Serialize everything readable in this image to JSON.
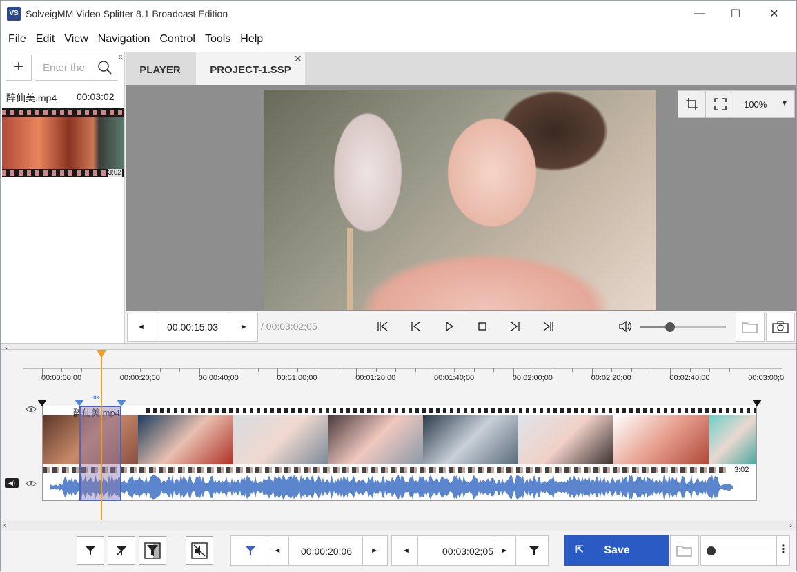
{
  "window": {
    "app_icon": "VS",
    "title": "SolveigMM Video Splitter 8.1 Broadcast Edition",
    "minimize": "—",
    "maximize": "☐",
    "close": "✕"
  },
  "menu": [
    "File",
    "Edit",
    "View",
    "Navigation",
    "Control",
    "Tools",
    "Help"
  ],
  "left_panel": {
    "add": "+",
    "search_placeholder": "Enter the",
    "collapse": "«",
    "file": {
      "name": "醉仙美.mp4",
      "duration": "00:03:02",
      "thumb_time": "3:02"
    }
  },
  "tabs": {
    "player": "PLAYER",
    "project": "PROJECT-1.SSP",
    "close": "✕"
  },
  "player": {
    "zoom": "100%",
    "zoom_arrow": "▼"
  },
  "transport": {
    "prev": "◄",
    "next": "►",
    "current_time": "00:00:15;03",
    "total_duration": "/ 00:03:02;05",
    "volume_level": 0.35
  },
  "timeline": {
    "ticks": [
      "00:00:00;00",
      "00:00:20;00",
      "00:00:40;00",
      "00:01:00;00",
      "00:01:20;00",
      "00:01:40;00",
      "00:02:00;00",
      "00:02:20;00",
      "00:02:40;00",
      "00:03:00;0"
    ],
    "track_label": "醉仙美.mp4",
    "track_end_time": "3:02",
    "sel_mid": "⇥⇤",
    "speaker": "◀)"
  },
  "bottom": {
    "start_time": "00:00:20;06",
    "end_time": "00:03:02;05",
    "prev": "◄",
    "next": "►",
    "save": "Save",
    "more": "⋮"
  },
  "colors": {
    "accent": "#2a5bc4",
    "playhead": "#f0a020",
    "selection": "#4a66c8",
    "waveform": "#5b85cc"
  }
}
